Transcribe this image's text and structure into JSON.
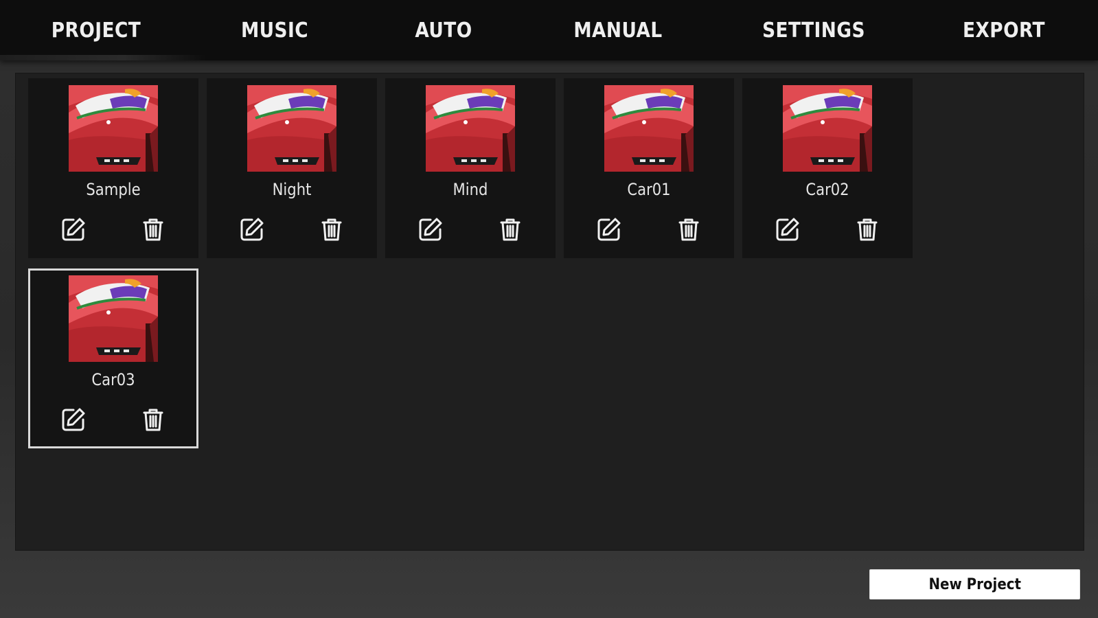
{
  "nav": {
    "tabs": [
      {
        "label": "PROJECT",
        "active": true
      },
      {
        "label": "MUSIC",
        "active": false
      },
      {
        "label": "AUTO",
        "active": false
      },
      {
        "label": "MANUAL",
        "active": false
      },
      {
        "label": "SETTINGS",
        "active": false
      },
      {
        "label": "EXPORT",
        "active": false
      }
    ]
  },
  "projects": [
    {
      "name": "Sample",
      "selected": false
    },
    {
      "name": "Night",
      "selected": false
    },
    {
      "name": "Mind",
      "selected": false
    },
    {
      "name": "Car01",
      "selected": false
    },
    {
      "name": "Car02",
      "selected": false
    },
    {
      "name": "Car03",
      "selected": true
    }
  ],
  "icons": {
    "edit": "edit-icon",
    "delete": "trash-icon"
  },
  "footer": {
    "new_project_label": "New Project"
  },
  "colors": {
    "nav_bg": "#0d0d0d",
    "panel_bg": "#1f1f1f",
    "card_bg": "#141414",
    "selected_border": "#d9d9d9",
    "button_bg": "#ffffff"
  }
}
